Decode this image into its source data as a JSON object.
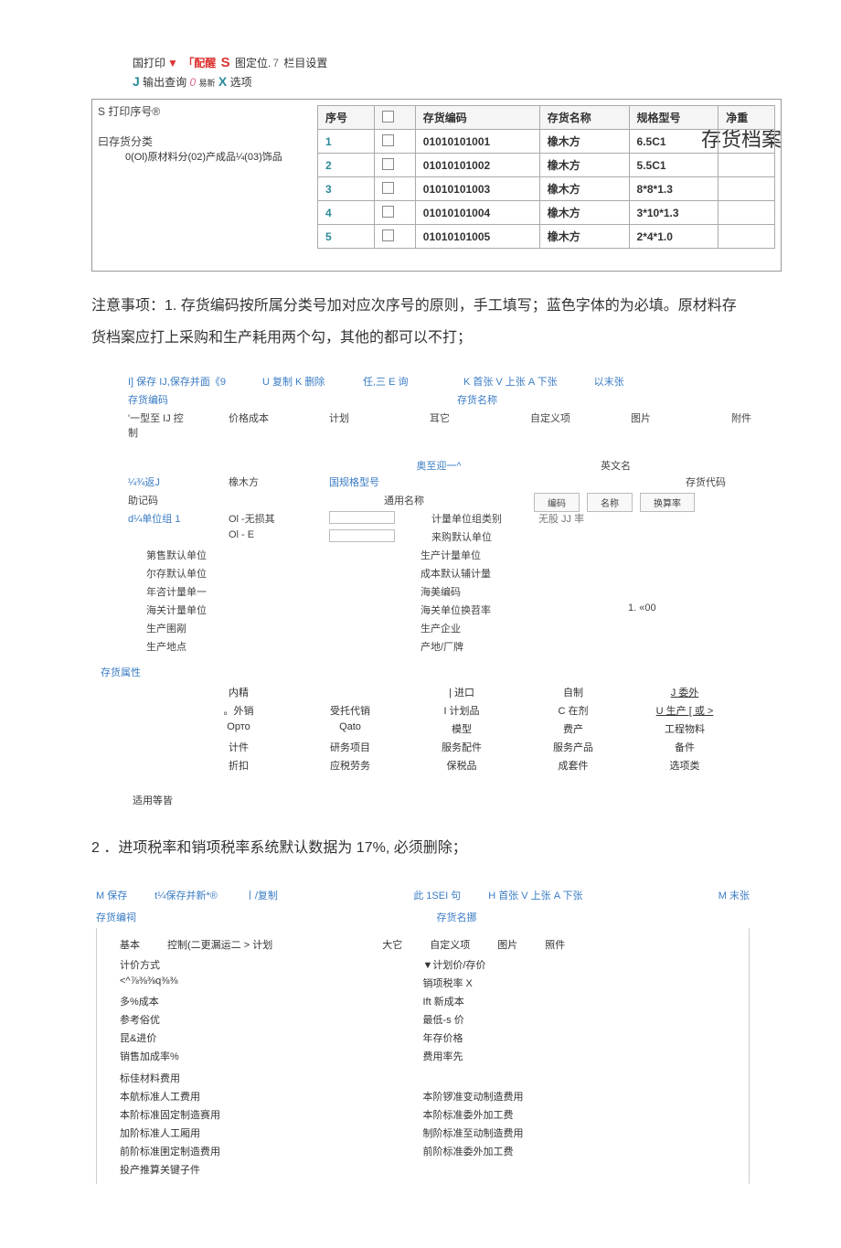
{
  "toolbar1": {
    "a": "国打印",
    "b": "▼",
    "c": "「配醒",
    "d": "S",
    "e": "图定位.",
    "f": "7",
    "g": "栏目设置"
  },
  "toolbar2": {
    "a": "J",
    "b": "输出查询",
    "c": "0",
    "d": "易新",
    "e": "X",
    "f": "选项"
  },
  "page_title": "存货档案",
  "panel1": {
    "top": "S 打印序号®",
    "tree_label": "曰存货分类",
    "tree_child": "0(Ol)原材料分(02)产成品¼(03)饰品",
    "headers": [
      "序号",
      "",
      "存货编码",
      "存货名称",
      "规格型号",
      "净重"
    ],
    "rows": [
      {
        "n": "1",
        "code": "01010101001",
        "name": "橡木方",
        "spec": "6.5C1"
      },
      {
        "n": "2",
        "code": "01010101002",
        "name": "橡木方",
        "spec": "5.5C1"
      },
      {
        "n": "3",
        "code": "01010101003",
        "name": "橡木方",
        "spec": "8*8*1.3"
      },
      {
        "n": "4",
        "code": "01010101004",
        "name": "橡木方",
        "spec": "3*10*1.3"
      },
      {
        "n": "5",
        "code": "01010101005",
        "name": "橡木方",
        "spec": "2*4*1.0"
      }
    ]
  },
  "note1": "注意事项：1. 存货编码按所属分类号加对应次序号的原则，手工填写；蓝色字体的为必填。原材料存货档案应打上采购和生产耗用两个勾，其他的都可以不打；",
  "form1_toolbar": {
    "save": "I] 保存 IJ,保存并面《9",
    "copy": "U 复制 K 删除",
    "ren": "任,三 E 询",
    "nav": "K 首张 V 上张 A 下张",
    "last": "以末张"
  },
  "form1_labels": {
    "code": "存货编码",
    "name": "存货名称",
    "tabrow": [
      "'一型至 IJ 控制",
      "价格成本",
      "计划",
      "耳它",
      "自定义项",
      "图片",
      "附件"
    ],
    "centre": "奥至迎一^",
    "eng": "英文名",
    "l1": "¼¾返J",
    "l1v": "橡木方",
    "spec": "国规格型号",
    "daima": "存货代码",
    "zhu": "助记码",
    "tong": "通用名称",
    "unit": "d¼单位组 1",
    "u1": "Ol -无损其",
    "u1r": "计量单位组类别",
    "u1r2": "无股 JJ 率",
    "u2": "Ol - E",
    "u2r": "来购默认单位",
    "rows": [
      "第售默认单位",
      "生产计量单位",
      "尔存默认单位",
      "成本默认辅计量",
      "年咨计量单一",
      "海美编码",
      "海关计量单位",
      "海关单位换苕率",
      "生产圉剐",
      "生产企业",
      "生产地点",
      "产地/厂牌"
    ],
    "val_customs": "1. «00",
    "mini": [
      "编码",
      "名称",
      "换算率"
    ]
  },
  "attr_title": "存货属性",
  "attr_rows": [
    [
      "内精",
      "",
      "| 进口",
      "自制",
      "J 委外"
    ],
    [
      "。外销",
      "受托代销",
      "I 计划品",
      "C 在剂",
      "U 生产 [ 或 >"
    ],
    [
      "Орто",
      "Qato",
      "模型",
      "费产",
      "工程物料"
    ],
    [
      "计件",
      "研务项目",
      "服务配件",
      "服务产品",
      "备件"
    ],
    [
      "折扣",
      "应税劳务",
      "保税品",
      "成套件",
      "选项类"
    ]
  ],
  "attr_foot": "适用等皆",
  "note2": "2 ．进项税率和销项税率系统默认数据为 17%, 必须删除；",
  "form2_toolbar": [
    "M 保存",
    "t¼保存并新*®",
    "丨/复制",
    "此 1SEI 句",
    "H 首张 V 上张 A 下张",
    "M 末张"
  ],
  "form2_tabs": {
    "code": "存货编祠",
    "name": "存货名挪",
    "row": [
      "基本",
      "控制(二更漏运二 > 计划",
      "大它",
      "自定义项",
      "图片",
      "照件"
    ],
    "center": "▼计划价/存价",
    "jijia": "计价方式"
  },
  "form2_rows": [
    {
      "l": "<^⅞⅜⅜q⅜⅜",
      "r": "销项税率 X"
    },
    {
      "l": "多%成本",
      "r": "Ift 新成本"
    },
    {
      "l": "参考俗优",
      "r": "最低-s 价"
    },
    {
      "l": "昆&进价",
      "r": "年存价格"
    },
    {
      "l": "销售加成率%",
      "r": "费用率先"
    },
    {
      "l": "",
      "r": ""
    },
    {
      "l": "标佳材料费用",
      "r": ""
    },
    {
      "l": "本航标准人工费用",
      "r": "本阶锣准变动制造费用"
    },
    {
      "l": "本阶标准固定制造赛用",
      "r": "本阶标准委外加工费"
    },
    {
      "l": "加阶标准人工厢用",
      "r": "制阶标准至动制造费用"
    },
    {
      "l": "前阶标准圉定制造费用",
      "r": "前阶标准委外加工费"
    },
    {
      "l": "投产推算关键子件",
      "r": ""
    }
  ]
}
